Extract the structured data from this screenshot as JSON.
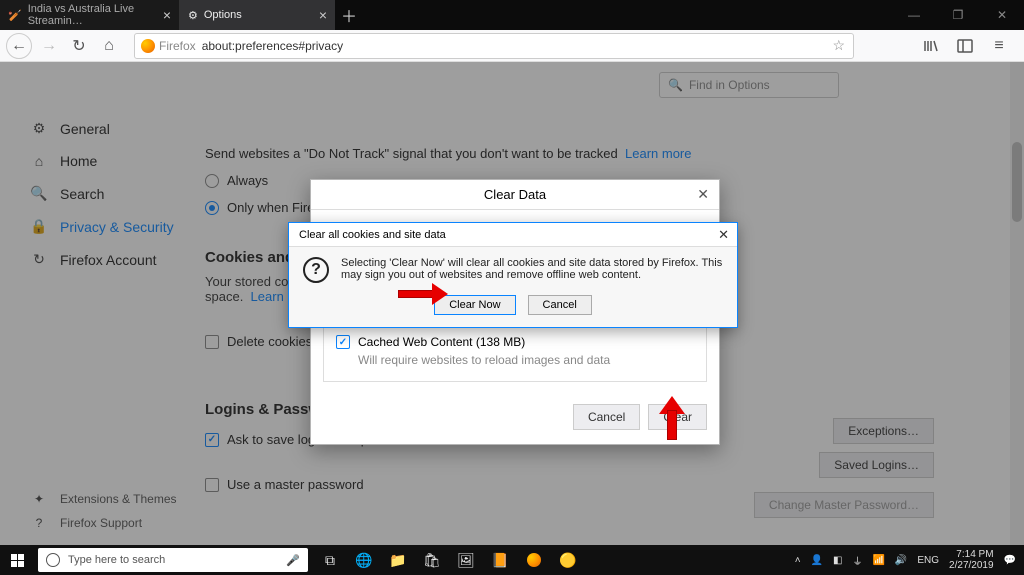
{
  "tabs": {
    "inactive": "India vs Australia Live Streamin…",
    "active": "Options"
  },
  "urlbar": {
    "brand": "Firefox",
    "url": "about:preferences#privacy"
  },
  "find_placeholder": "Find in Options",
  "sidebar": {
    "general": "General",
    "home": "Home",
    "search": "Search",
    "privacy": "Privacy & Security",
    "account": "Firefox Account",
    "ext": "Extensions & Themes",
    "support": "Firefox Support"
  },
  "page": {
    "dnt_text": "Send websites a \"Do Not Track\" signal that you don't want to be tracked",
    "learn_more": "Learn more",
    "r_always": "Always",
    "r_only": "Only when Firef",
    "cookies_h": "Cookies and Si",
    "cookies_p1": "Your stored cooki",
    "cookies_p2": "space.",
    "delete_cookies": "Delete cookies an",
    "logins_h": "Logins & Passwor",
    "ask_save": "Ask to save logins and passwords for websites",
    "exceptions": "Exceptions…",
    "saved_logins": "Saved Logins…",
    "master_pw": "Use a master password",
    "change_master": "Change Master Password…"
  },
  "modal1": {
    "title": "Clear Data",
    "cache_label": "Cached Web Content (138 MB)",
    "cache_sub": "Will require websites to reload images and data",
    "cancel": "Cancel",
    "clear": "Clear"
  },
  "modal2": {
    "title": "Clear all cookies and site data",
    "body": "Selecting 'Clear Now' will clear all cookies and site data stored by Firefox. This may sign you out of websites and remove offline web content.",
    "clear_now": "Clear Now",
    "cancel": "Cancel"
  },
  "taskbar": {
    "search_placeholder": "Type here to search",
    "lang": "ENG",
    "time": "7:14 PM",
    "date": "2/27/2019"
  }
}
